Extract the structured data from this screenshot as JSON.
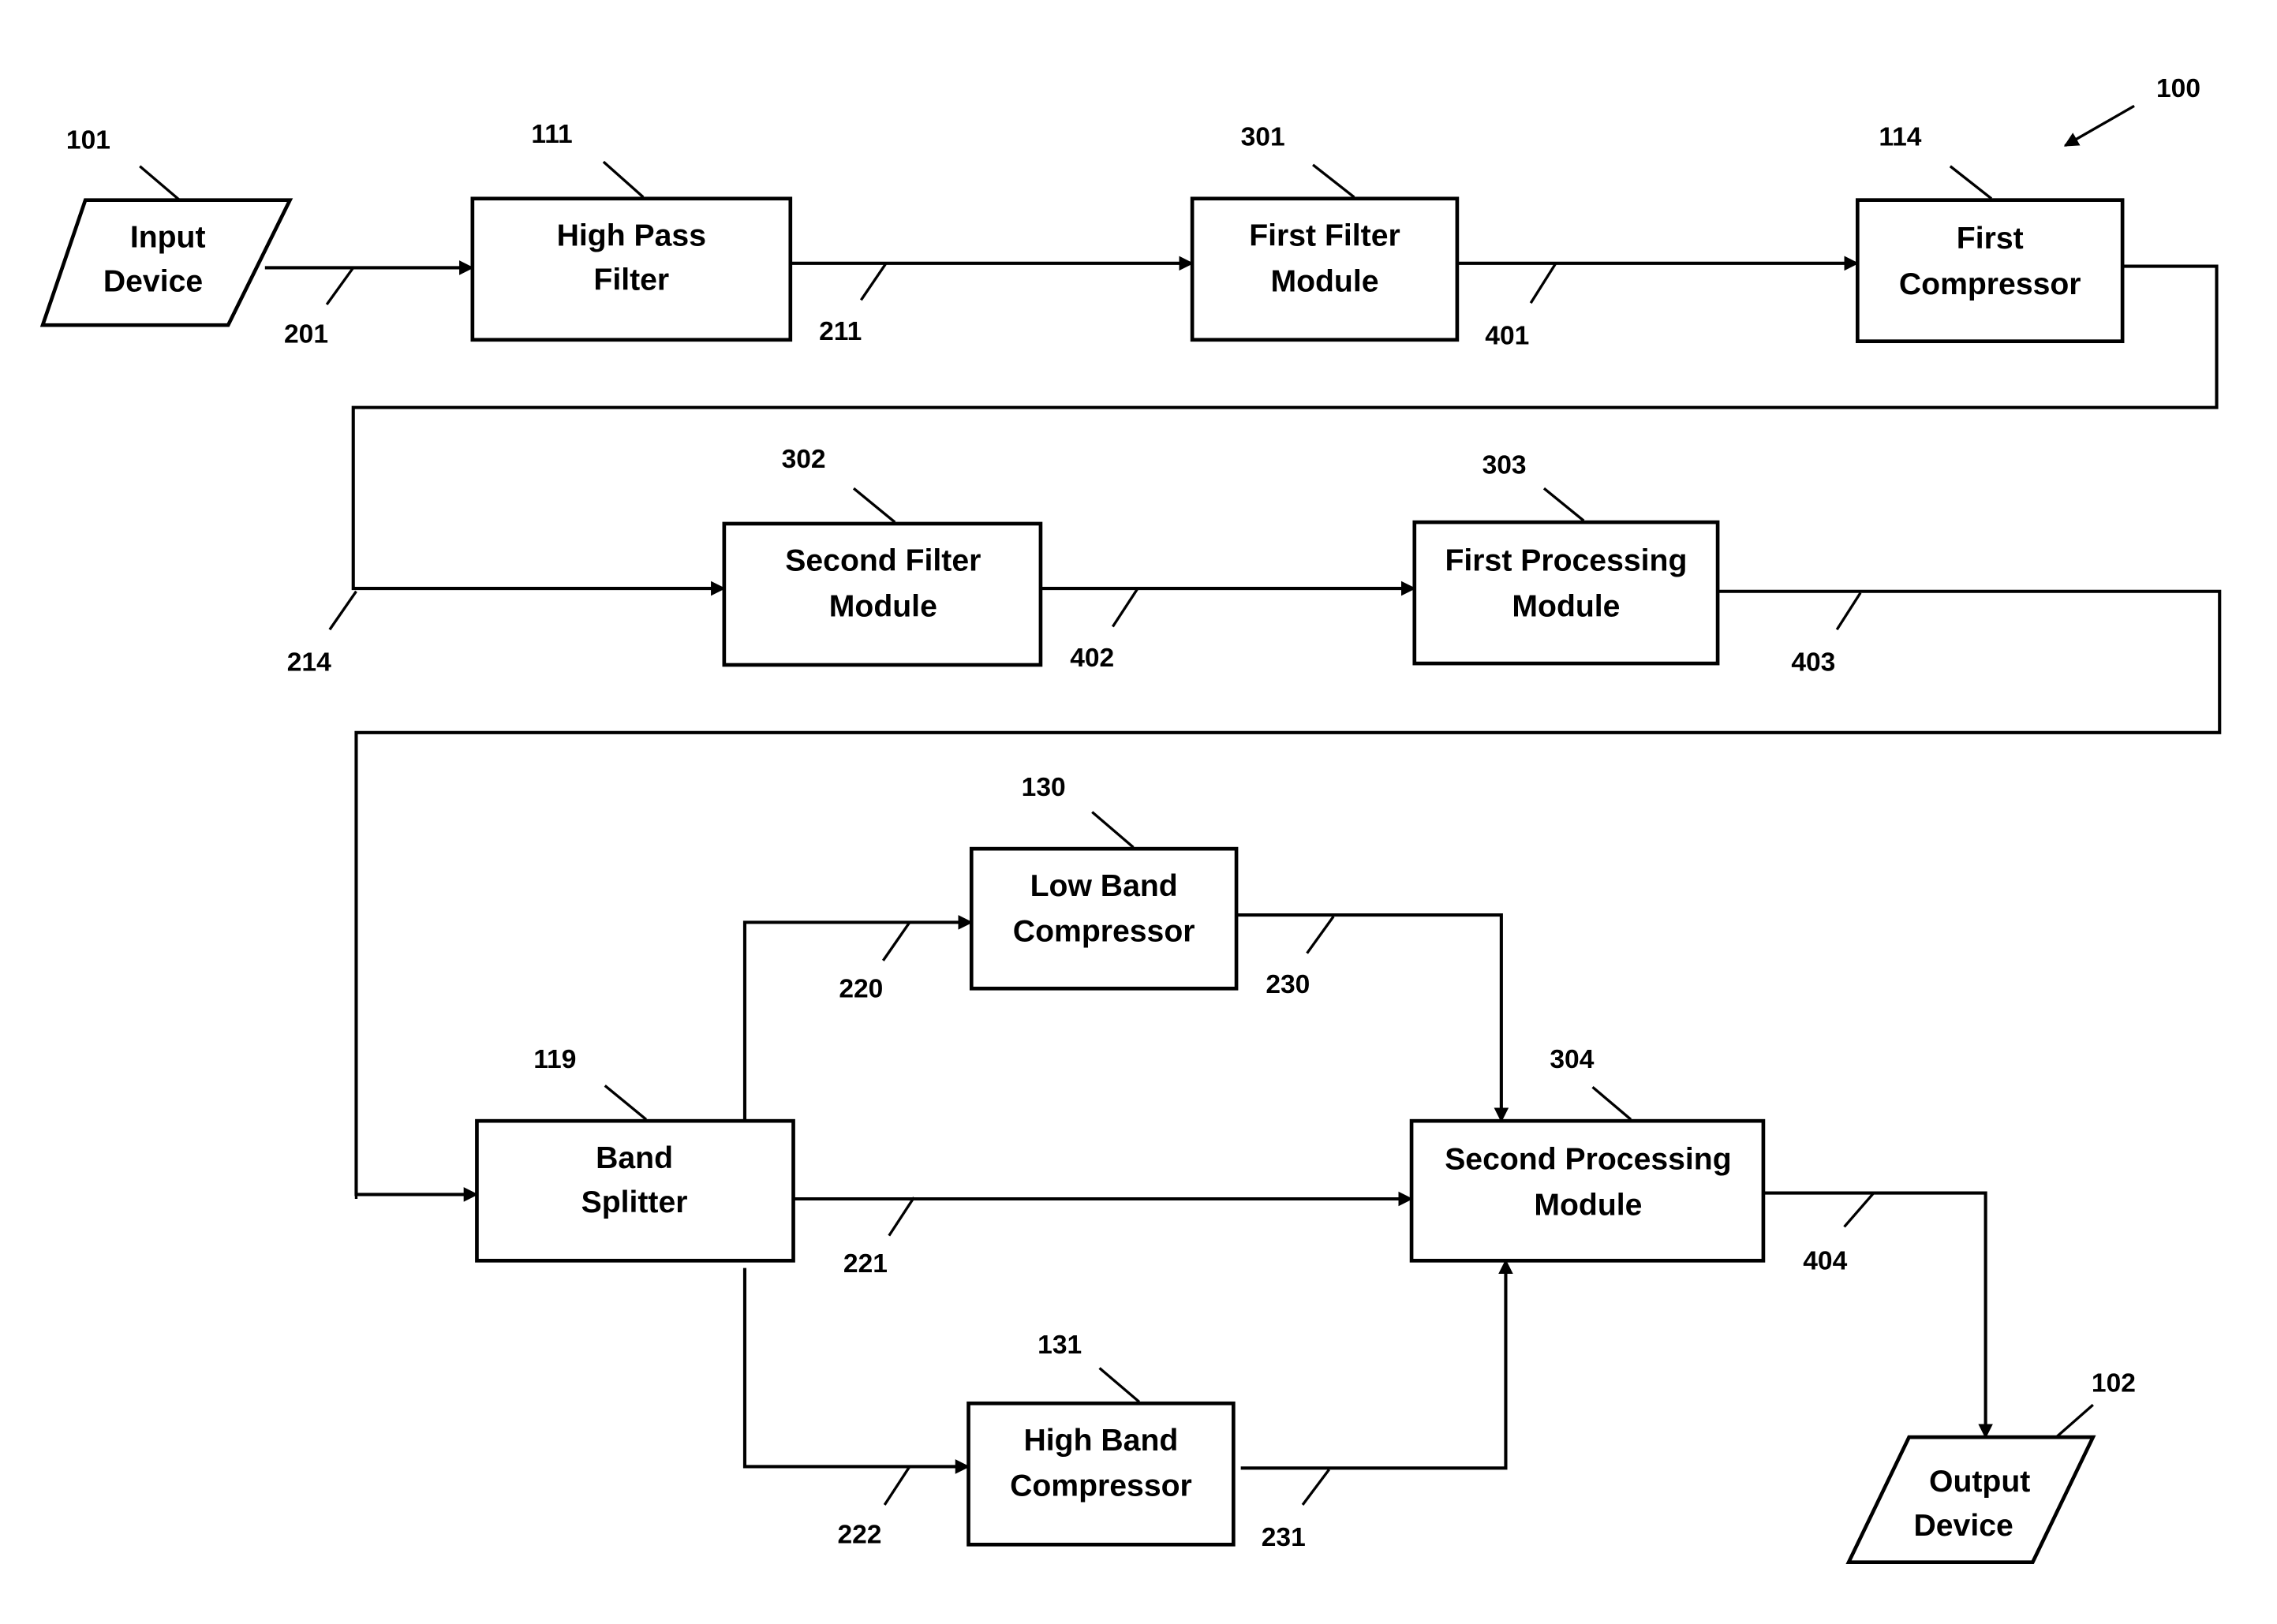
{
  "figure": {
    "reference": "100"
  },
  "blocks": {
    "input_device": {
      "ref": "101",
      "line1": "Input",
      "line2": "Device"
    },
    "high_pass_filter": {
      "ref": "111",
      "line1": "High Pass",
      "line2": "Filter"
    },
    "first_filter_module": {
      "ref": "301",
      "line1": "First Filter",
      "line2": "Module"
    },
    "first_compressor": {
      "ref": "114",
      "line1": "First",
      "line2": "Compressor"
    },
    "second_filter_module": {
      "ref": "302",
      "line1": "Second Filter",
      "line2": "Module"
    },
    "first_processing_module": {
      "ref": "303",
      "line1": "First Processing",
      "line2": "Module"
    },
    "low_band_compressor": {
      "ref": "130",
      "line1": "Low Band",
      "line2": "Compressor"
    },
    "band_splitter": {
      "ref": "119",
      "line1": "Band",
      "line2": "Splitter"
    },
    "second_processing_module": {
      "ref": "304",
      "line1": "Second Processing",
      "line2": "Module"
    },
    "high_band_compressor": {
      "ref": "131",
      "line1": "High Band",
      "line2": "Compressor"
    },
    "output_device": {
      "ref": "102",
      "line1": "Output",
      "line2": "Device"
    }
  },
  "signals": {
    "s201": "201",
    "s211": "211",
    "s401": "401",
    "s214": "214",
    "s402": "402",
    "s403": "403",
    "s220": "220",
    "s230": "230",
    "s221": "221",
    "s222": "222",
    "s231": "231",
    "s404": "404"
  }
}
